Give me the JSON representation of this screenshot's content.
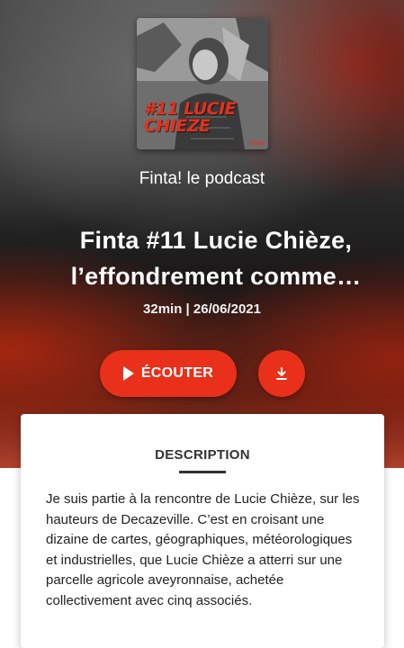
{
  "podcast": {
    "cover": {
      "episode_text": "#11 LUCIE CHIEZE",
      "brand_text": "Finta!"
    },
    "show_name": "Finta! le podcast",
    "episode_title_line1": "Finta #11 Lucie Chièze,",
    "episode_title_line2": "l’effondrement comme…",
    "meta": "32min | 26/06/2021"
  },
  "actions": {
    "listen_label": "ÉCOUTER",
    "play_icon": "play-icon",
    "download_icon": "download-icon"
  },
  "description": {
    "tab_label": "DESCRIPTION",
    "text": "Je suis partie à la rencontre de Lucie Chièze, sur les hauteurs de Decazeville. C’est en croisant une dizaine de cartes, géographiques, météorologiques et industrielles, que Lucie Chièze a atterri sur une parcelle agricole aveyronnaise, achetée collectivement avec cinq associés."
  },
  "colors": {
    "accent": "#e8301a",
    "text_dark": "#333333"
  }
}
